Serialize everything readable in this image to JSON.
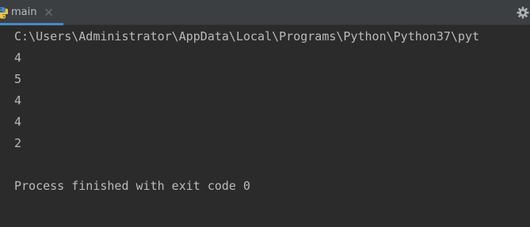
{
  "tab": {
    "label": "main",
    "icon": "python-icon"
  },
  "toolbar": {
    "settings_icon": "gear-icon"
  },
  "console": {
    "path_line": "C:\\Users\\Administrator\\AppData\\Local\\Programs\\Python\\Python37\\pyt",
    "output": [
      "4",
      "5",
      "4",
      "4",
      "2"
    ],
    "exit_message": "Process finished with exit code 0"
  },
  "colors": {
    "background": "#2b2b2b",
    "tabbar": "#3c3f41",
    "text": "#bbbbbb",
    "tab_underline": "#4a88c7"
  }
}
